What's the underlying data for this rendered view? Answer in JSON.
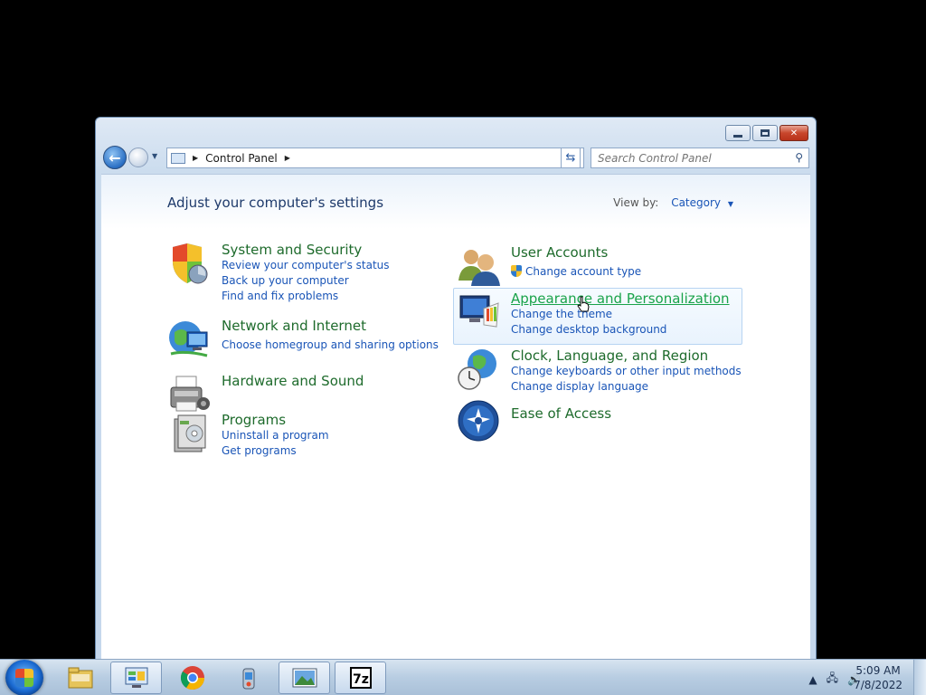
{
  "window": {
    "controls": {
      "minimize": "▭",
      "maximize": "□",
      "close": "✕"
    }
  },
  "navbar": {
    "address_path": [
      "Control Panel"
    ],
    "search_placeholder": "Search Control Panel"
  },
  "page": {
    "title": "Adjust your computer's settings",
    "view_by_label": "View by:",
    "view_by_value": "Category"
  },
  "categories_left": [
    {
      "title": "System and Security",
      "icon": "shield-icon",
      "links": [
        "Review your computer's status",
        "Back up your computer",
        "Find and fix problems"
      ]
    },
    {
      "title": "Network and Internet",
      "icon": "network-globe-icon",
      "links": [
        "Choose homegroup and sharing options"
      ]
    },
    {
      "title": "Hardware and Sound",
      "icon": "printer-icon",
      "links": []
    },
    {
      "title": "Programs",
      "icon": "programs-box-icon",
      "links": [
        "Uninstall a program",
        "Get programs"
      ]
    }
  ],
  "categories_right": [
    {
      "title": "User Accounts",
      "icon": "users-icon",
      "links": [
        "Change account type"
      ]
    },
    {
      "title": "Appearance and Personalization",
      "icon": "monitor-palette-icon",
      "links": [
        "Change the theme",
        "Change desktop background"
      ]
    },
    {
      "title": "Clock, Language, and Region",
      "icon": "globe-clock-icon",
      "links": [
        "Change keyboards or other input methods",
        "Change display language"
      ]
    },
    {
      "title": "Ease of Access",
      "icon": "ease-of-access-icon",
      "links": []
    }
  ],
  "taskbar": {
    "apps": [
      "file-explorer-icon",
      "control-panel-icon",
      "chrome-icon",
      "recycle-bin-icon",
      "image-viewer-icon",
      "7zip-icon"
    ],
    "clock_time": "5:09 AM",
    "clock_date": "7/8/2022"
  }
}
